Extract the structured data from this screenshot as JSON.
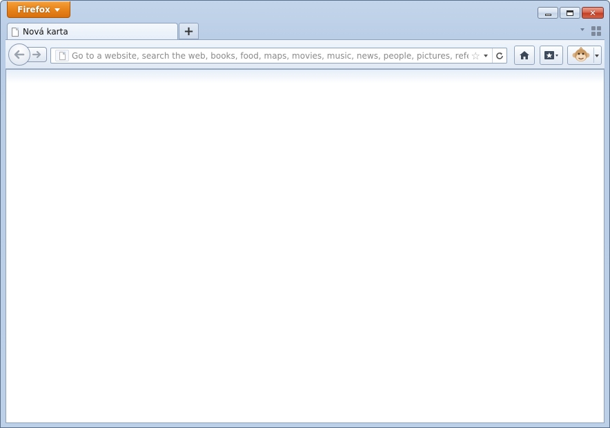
{
  "app": {
    "menu_button_label": "Firefox"
  },
  "tabs": [
    {
      "label": "Nová karta",
      "active": true
    }
  ],
  "urlbar": {
    "placeholder": "Go to a website, search the web, books, food, maps, movies, music, news, people, pictures, references, shopping...",
    "value": ""
  },
  "icons": {
    "window_minimize": "minimize-icon",
    "window_maximize": "maximize-icon",
    "window_close": "close-icon",
    "new_tab": "plus-icon",
    "tab_list": "chevron-down-icon",
    "tab_groups": "tab-groups-icon",
    "back": "back-arrow-icon",
    "forward": "forward-arrow-icon",
    "site_identity": "blank-page-icon",
    "bookmark_star": "star-icon",
    "history_dropdown": "chevron-down-icon",
    "reload": "reload-icon",
    "home": "home-icon",
    "bookmarks": "bookmarks-icon",
    "persona": "monkey-face-icon"
  },
  "colors": {
    "firefox_button": "#e8851c",
    "chrome_background": "#bcd0e8",
    "close_button": "#c23c22",
    "content_background": "#ffffff"
  }
}
